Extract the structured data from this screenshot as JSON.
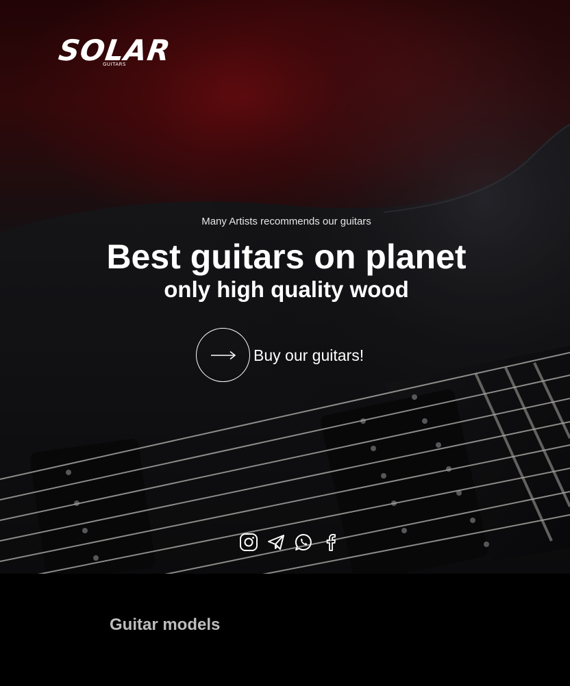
{
  "brand": {
    "logo_text": "SOLAR",
    "logo_subtext": "GUITARS"
  },
  "hero": {
    "tagline": "Many Artists recommends our guitars",
    "headline": "Best guitars on planet",
    "subheadline": "only high quality wood",
    "cta_label": "Buy our guitars!"
  },
  "social": {
    "items": [
      {
        "icon": "instagram-icon"
      },
      {
        "icon": "telegram-icon"
      },
      {
        "icon": "whatsapp-icon"
      },
      {
        "icon": "facebook-icon"
      }
    ]
  },
  "models": {
    "title": "Guitar models"
  },
  "colors": {
    "background": "#000000",
    "text_primary": "#ffffff",
    "section_title": "#bdbdbd",
    "hero_red": "#6e0e12"
  }
}
